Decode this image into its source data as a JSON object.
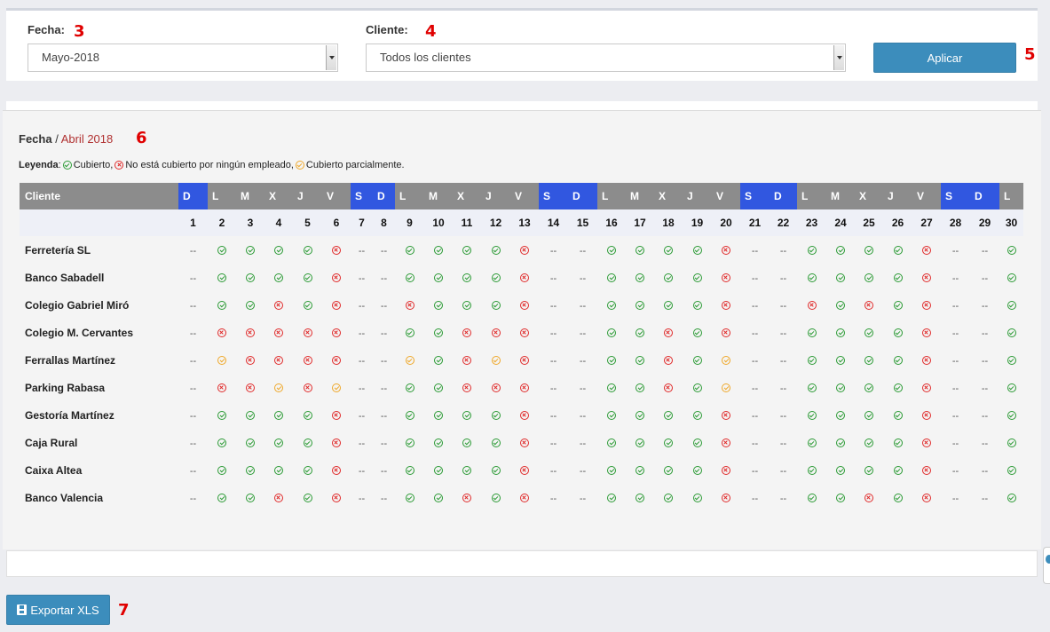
{
  "filters": {
    "fecha_label": "Fecha:",
    "fecha_value": "Mayo-2018",
    "cliente_label": "Cliente:",
    "cliente_value": "Todos los clientes",
    "apply_label": "Aplicar"
  },
  "annotations": [
    "3",
    "4",
    "5",
    "6",
    "7"
  ],
  "breadcrumb": {
    "root": "Fecha",
    "separator": " / ",
    "current": "Abril 2018"
  },
  "legend": {
    "label": "Leyenda",
    "items": [
      {
        "status": "ok",
        "text": "Cubierto,"
      },
      {
        "status": "no",
        "text": "No está cubierto por ningún empleado,"
      },
      {
        "status": "part",
        "text": "Cubierto parcialmente."
      }
    ]
  },
  "table": {
    "client_header": "Cliente",
    "days": [
      {
        "n": "1",
        "d": "D"
      },
      {
        "n": "2",
        "d": "L"
      },
      {
        "n": "3",
        "d": "M"
      },
      {
        "n": "4",
        "d": "X"
      },
      {
        "n": "5",
        "d": "J"
      },
      {
        "n": "6",
        "d": "V"
      },
      {
        "n": "7",
        "d": "S"
      },
      {
        "n": "8",
        "d": "D"
      },
      {
        "n": "9",
        "d": "L"
      },
      {
        "n": "10",
        "d": "M"
      },
      {
        "n": "11",
        "d": "X"
      },
      {
        "n": "12",
        "d": "J"
      },
      {
        "n": "13",
        "d": "V"
      },
      {
        "n": "14",
        "d": "S"
      },
      {
        "n": "15",
        "d": "D"
      },
      {
        "n": "16",
        "d": "L"
      },
      {
        "n": "17",
        "d": "M"
      },
      {
        "n": "18",
        "d": "X"
      },
      {
        "n": "19",
        "d": "J"
      },
      {
        "n": "20",
        "d": "V"
      },
      {
        "n": "21",
        "d": "S"
      },
      {
        "n": "22",
        "d": "D"
      },
      {
        "n": "23",
        "d": "L"
      },
      {
        "n": "24",
        "d": "M"
      },
      {
        "n": "25",
        "d": "X"
      },
      {
        "n": "26",
        "d": "J"
      },
      {
        "n": "27",
        "d": "V"
      },
      {
        "n": "28",
        "d": "S"
      },
      {
        "n": "29",
        "d": "D"
      },
      {
        "n": "30",
        "d": "L"
      }
    ],
    "dash_text": "--",
    "rows": [
      {
        "name": "Ferretería SL",
        "cells": [
          "-",
          "o",
          "o",
          "o",
          "o",
          "x",
          "-",
          "-",
          "o",
          "o",
          "o",
          "o",
          "x",
          "-",
          "-",
          "o",
          "o",
          "o",
          "o",
          "x",
          "-",
          "-",
          "o",
          "o",
          "o",
          "o",
          "x",
          "-",
          "-",
          "o"
        ]
      },
      {
        "name": "Banco Sabadell",
        "cells": [
          "-",
          "o",
          "o",
          "o",
          "o",
          "x",
          "-",
          "-",
          "o",
          "o",
          "o",
          "o",
          "x",
          "-",
          "-",
          "o",
          "o",
          "o",
          "o",
          "x",
          "-",
          "-",
          "o",
          "o",
          "o",
          "o",
          "x",
          "-",
          "-",
          "o"
        ]
      },
      {
        "name": "Colegio Gabriel Miró",
        "cells": [
          "-",
          "o",
          "o",
          "x",
          "o",
          "x",
          "-",
          "-",
          "x",
          "o",
          "o",
          "o",
          "x",
          "-",
          "-",
          "o",
          "o",
          "o",
          "o",
          "x",
          "-",
          "-",
          "x",
          "o",
          "x",
          "o",
          "x",
          "-",
          "-",
          "o"
        ]
      },
      {
        "name": "Colegio M. Cervantes",
        "cells": [
          "-",
          "x",
          "x",
          "x",
          "x",
          "x",
          "-",
          "-",
          "o",
          "o",
          "x",
          "x",
          "x",
          "-",
          "-",
          "o",
          "o",
          "x",
          "o",
          "x",
          "-",
          "-",
          "o",
          "o",
          "o",
          "o",
          "x",
          "-",
          "-",
          "o"
        ]
      },
      {
        "name": "Ferrallas Martínez",
        "cells": [
          "-",
          "p",
          "x",
          "x",
          "x",
          "x",
          "-",
          "-",
          "p",
          "o",
          "x",
          "p",
          "x",
          "-",
          "-",
          "o",
          "o",
          "x",
          "o",
          "p",
          "-",
          "-",
          "o",
          "o",
          "o",
          "o",
          "x",
          "-",
          "-",
          "o"
        ]
      },
      {
        "name": "Parking Rabasa",
        "cells": [
          "-",
          "x",
          "x",
          "p",
          "x",
          "p",
          "-",
          "-",
          "o",
          "o",
          "x",
          "x",
          "x",
          "-",
          "-",
          "o",
          "o",
          "x",
          "o",
          "p",
          "-",
          "-",
          "o",
          "o",
          "o",
          "o",
          "x",
          "-",
          "-",
          "o"
        ]
      },
      {
        "name": "Gestoría Martínez",
        "cells": [
          "-",
          "o",
          "o",
          "o",
          "o",
          "x",
          "-",
          "-",
          "o",
          "o",
          "o",
          "o",
          "x",
          "-",
          "-",
          "o",
          "o",
          "o",
          "o",
          "x",
          "-",
          "-",
          "o",
          "o",
          "o",
          "o",
          "x",
          "-",
          "-",
          "o"
        ]
      },
      {
        "name": "Caja Rural",
        "cells": [
          "-",
          "o",
          "o",
          "o",
          "o",
          "x",
          "-",
          "-",
          "o",
          "o",
          "o",
          "o",
          "x",
          "-",
          "-",
          "o",
          "o",
          "o",
          "o",
          "x",
          "-",
          "-",
          "o",
          "o",
          "o",
          "o",
          "x",
          "-",
          "-",
          "o"
        ]
      },
      {
        "name": "Caixa Altea",
        "cells": [
          "-",
          "o",
          "o",
          "o",
          "o",
          "x",
          "-",
          "-",
          "o",
          "o",
          "o",
          "o",
          "x",
          "-",
          "-",
          "o",
          "o",
          "o",
          "o",
          "x",
          "-",
          "-",
          "o",
          "o",
          "o",
          "o",
          "x",
          "-",
          "-",
          "o"
        ]
      },
      {
        "name": "Banco Valencia",
        "cells": [
          "-",
          "o",
          "o",
          "x",
          "o",
          "x",
          "-",
          "-",
          "o",
          "o",
          "x",
          "o",
          "x",
          "-",
          "-",
          "o",
          "o",
          "o",
          "o",
          "x",
          "-",
          "-",
          "o",
          "o",
          "x",
          "o",
          "x",
          "-",
          "-",
          "o"
        ]
      }
    ]
  },
  "export_label": "Exportar XLS",
  "colors": {
    "primary": "#3c8dbc",
    "weekend": "#3157e0",
    "header": "#8c8c8c",
    "ok": "#2a9a34",
    "no": "#e02a2a",
    "partial": "#efa82a",
    "annotation": "#e00000"
  },
  "icons": {
    "export": "floppy-icon",
    "ok": "check-circle-icon",
    "no": "x-circle-icon",
    "partial": "partial-check-circle-icon"
  }
}
